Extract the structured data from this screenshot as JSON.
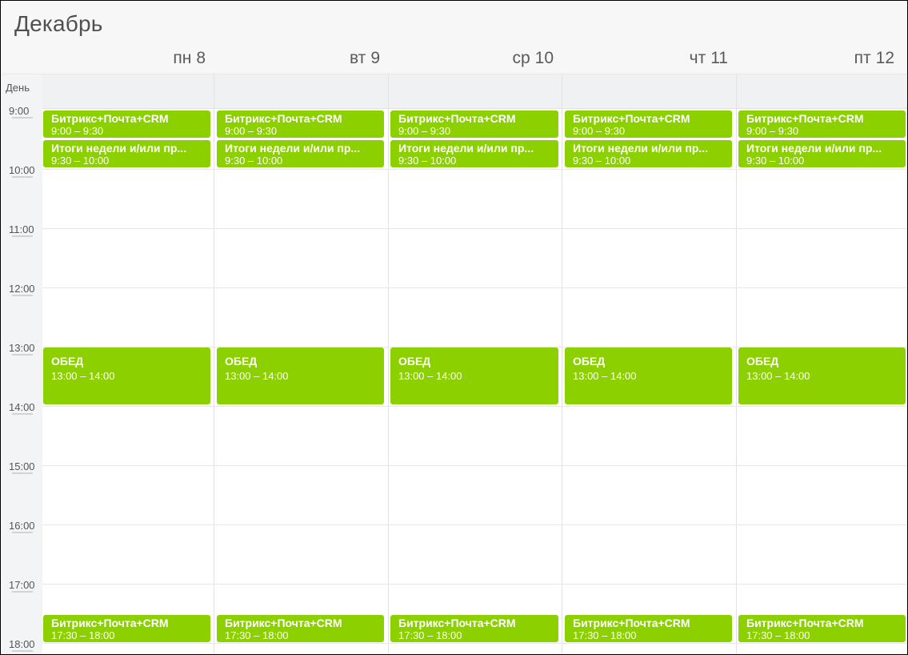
{
  "header": {
    "month": "Декабрь"
  },
  "days": [
    {
      "dow": "пн",
      "num": "8"
    },
    {
      "dow": "вт",
      "num": "9"
    },
    {
      "dow": "ср",
      "num": "10"
    },
    {
      "dow": "чт",
      "num": "11"
    },
    {
      "dow": "пт",
      "num": "12"
    }
  ],
  "allday_label": "День",
  "hours": [
    "9:00",
    "10:00",
    "11:00",
    "12:00",
    "13:00",
    "14:00",
    "15:00",
    "16:00",
    "17:00",
    "18:00"
  ],
  "events": {
    "bitrix_morning": {
      "title": "Битрикс+Почта+CRM",
      "time": "9:00 – 9:30"
    },
    "itogi": {
      "title": "Итоги недели и/или пр...",
      "time": "9:30 – 10:00"
    },
    "obed": {
      "title": "ОБЕД",
      "time": "13:00 – 14:00"
    },
    "bitrix_evening": {
      "title": "Битрикс+Почта+CRM",
      "time": "17:30 – 18:00"
    }
  },
  "colors": {
    "event_green": "#8cd000"
  }
}
